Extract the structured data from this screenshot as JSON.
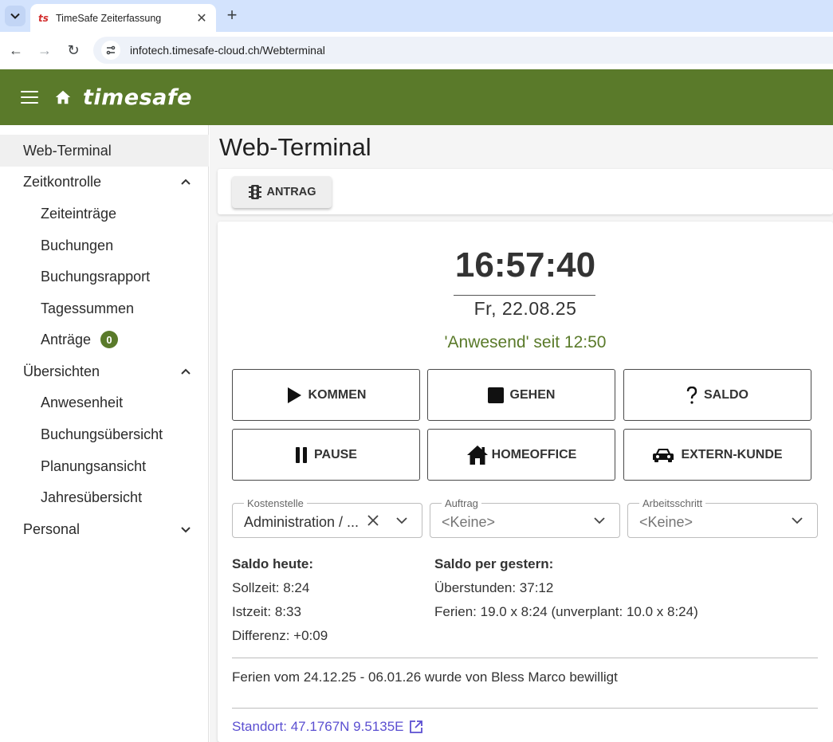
{
  "browser": {
    "tab_title": "TimeSafe Zeiterfassung",
    "favicon_text": "ts",
    "url": "infotech.timesafe-cloud.ch/Webterminal",
    "close_glyph": "✕",
    "new_tab_glyph": "+",
    "back_glyph": "←",
    "forward_glyph": "→",
    "reload_glyph": "↻"
  },
  "header": {
    "brand": "timesafe",
    "color": "#5a7a2a"
  },
  "sidebar": {
    "items": [
      {
        "label": "Web-Terminal"
      },
      {
        "label": "Zeitkontrolle"
      },
      {
        "label": "Zeiteinträge"
      },
      {
        "label": "Buchungen"
      },
      {
        "label": "Buchungsrapport"
      },
      {
        "label": "Tagessummen"
      },
      {
        "label": "Anträge",
        "badge": "0"
      },
      {
        "label": "Übersichten"
      },
      {
        "label": "Anwesenheit"
      },
      {
        "label": "Buchungsübersicht"
      },
      {
        "label": "Planungsansicht"
      },
      {
        "label": "Jahresübersicht"
      },
      {
        "label": "Personal"
      }
    ]
  },
  "main": {
    "title": "Web-Terminal",
    "antrag_label": "ANTRAG",
    "clock": "16:57:40",
    "date": "Fr, 22.08.25",
    "status": "'Anwesend' seit 12:50",
    "buttons": {
      "kommen": "KOMMEN",
      "gehen": "GEHEN",
      "saldo": "SALDO",
      "pause": "PAUSE",
      "homeoffice": "HOMEOFFICE",
      "extern": "EXTERN-KUNDE"
    },
    "selects": {
      "kostenstelle": {
        "label": "Kostenstelle",
        "value": "Administration / ..."
      },
      "auftrag": {
        "label": "Auftrag",
        "value": "<Keine>"
      },
      "arbeitsschritt": {
        "label": "Arbeitsschritt",
        "value": "<Keine>"
      }
    },
    "saldo_heute": {
      "title": "Saldo heute:",
      "sollzeit": "Sollzeit: 8:24",
      "istzeit": "Istzeit: 8:33",
      "differenz": "Differenz: +0:09"
    },
    "saldo_gestern": {
      "title": "Saldo per gestern:",
      "ueberstunden": "Überstunden: 37:12",
      "ferien": "Ferien: 19.0 x 8:24 (unverplant: 10.0 x 8:24)"
    },
    "note": "Ferien vom 24.12.25 - 06.01.26 wurde von Bless Marco bewilligt",
    "location": "Standort: 47.1767N 9.5135E"
  }
}
